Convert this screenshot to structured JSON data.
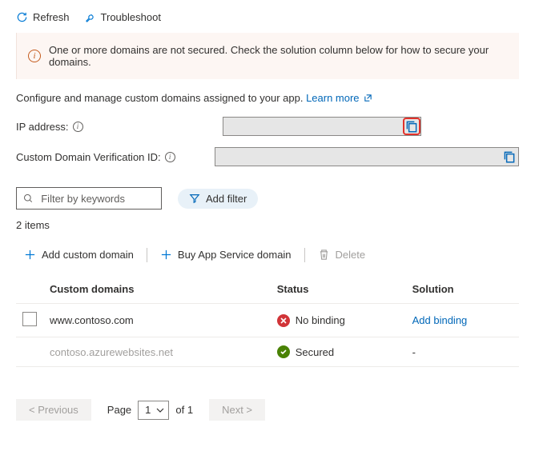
{
  "toolbar": {
    "refresh": "Refresh",
    "troubleshoot": "Troubleshoot"
  },
  "banner": {
    "message": "One or more domains are not secured. Check the solution column below for how to secure your domains."
  },
  "intro": {
    "text": "Configure and manage custom domains assigned to your app. ",
    "link": "Learn more"
  },
  "fields": {
    "ip_label": "IP address:",
    "ip_value": "",
    "cd_label": "Custom Domain Verification ID:",
    "cd_value": ""
  },
  "filters": {
    "search_placeholder": "Filter by keywords",
    "add_filter": "Add filter"
  },
  "count": "2 items",
  "actions": {
    "add_custom": "Add custom domain",
    "buy": "Buy App Service domain",
    "delete": "Delete"
  },
  "table": {
    "headers": {
      "domain": "Custom domains",
      "status": "Status",
      "solution": "Solution"
    },
    "rows": [
      {
        "domain": "www.contoso.com",
        "status_icon": "err",
        "status": "No binding",
        "solution": "Add binding",
        "solution_link": true,
        "selectable": true
      },
      {
        "domain": "contoso.azurewebsites.net",
        "status_icon": "ok",
        "status": "Secured",
        "solution": "-",
        "solution_link": false,
        "selectable": false
      }
    ]
  },
  "pager": {
    "prev": "< Previous",
    "page_label": "Page",
    "page_value": "1",
    "of": "of 1",
    "next": "Next >"
  }
}
